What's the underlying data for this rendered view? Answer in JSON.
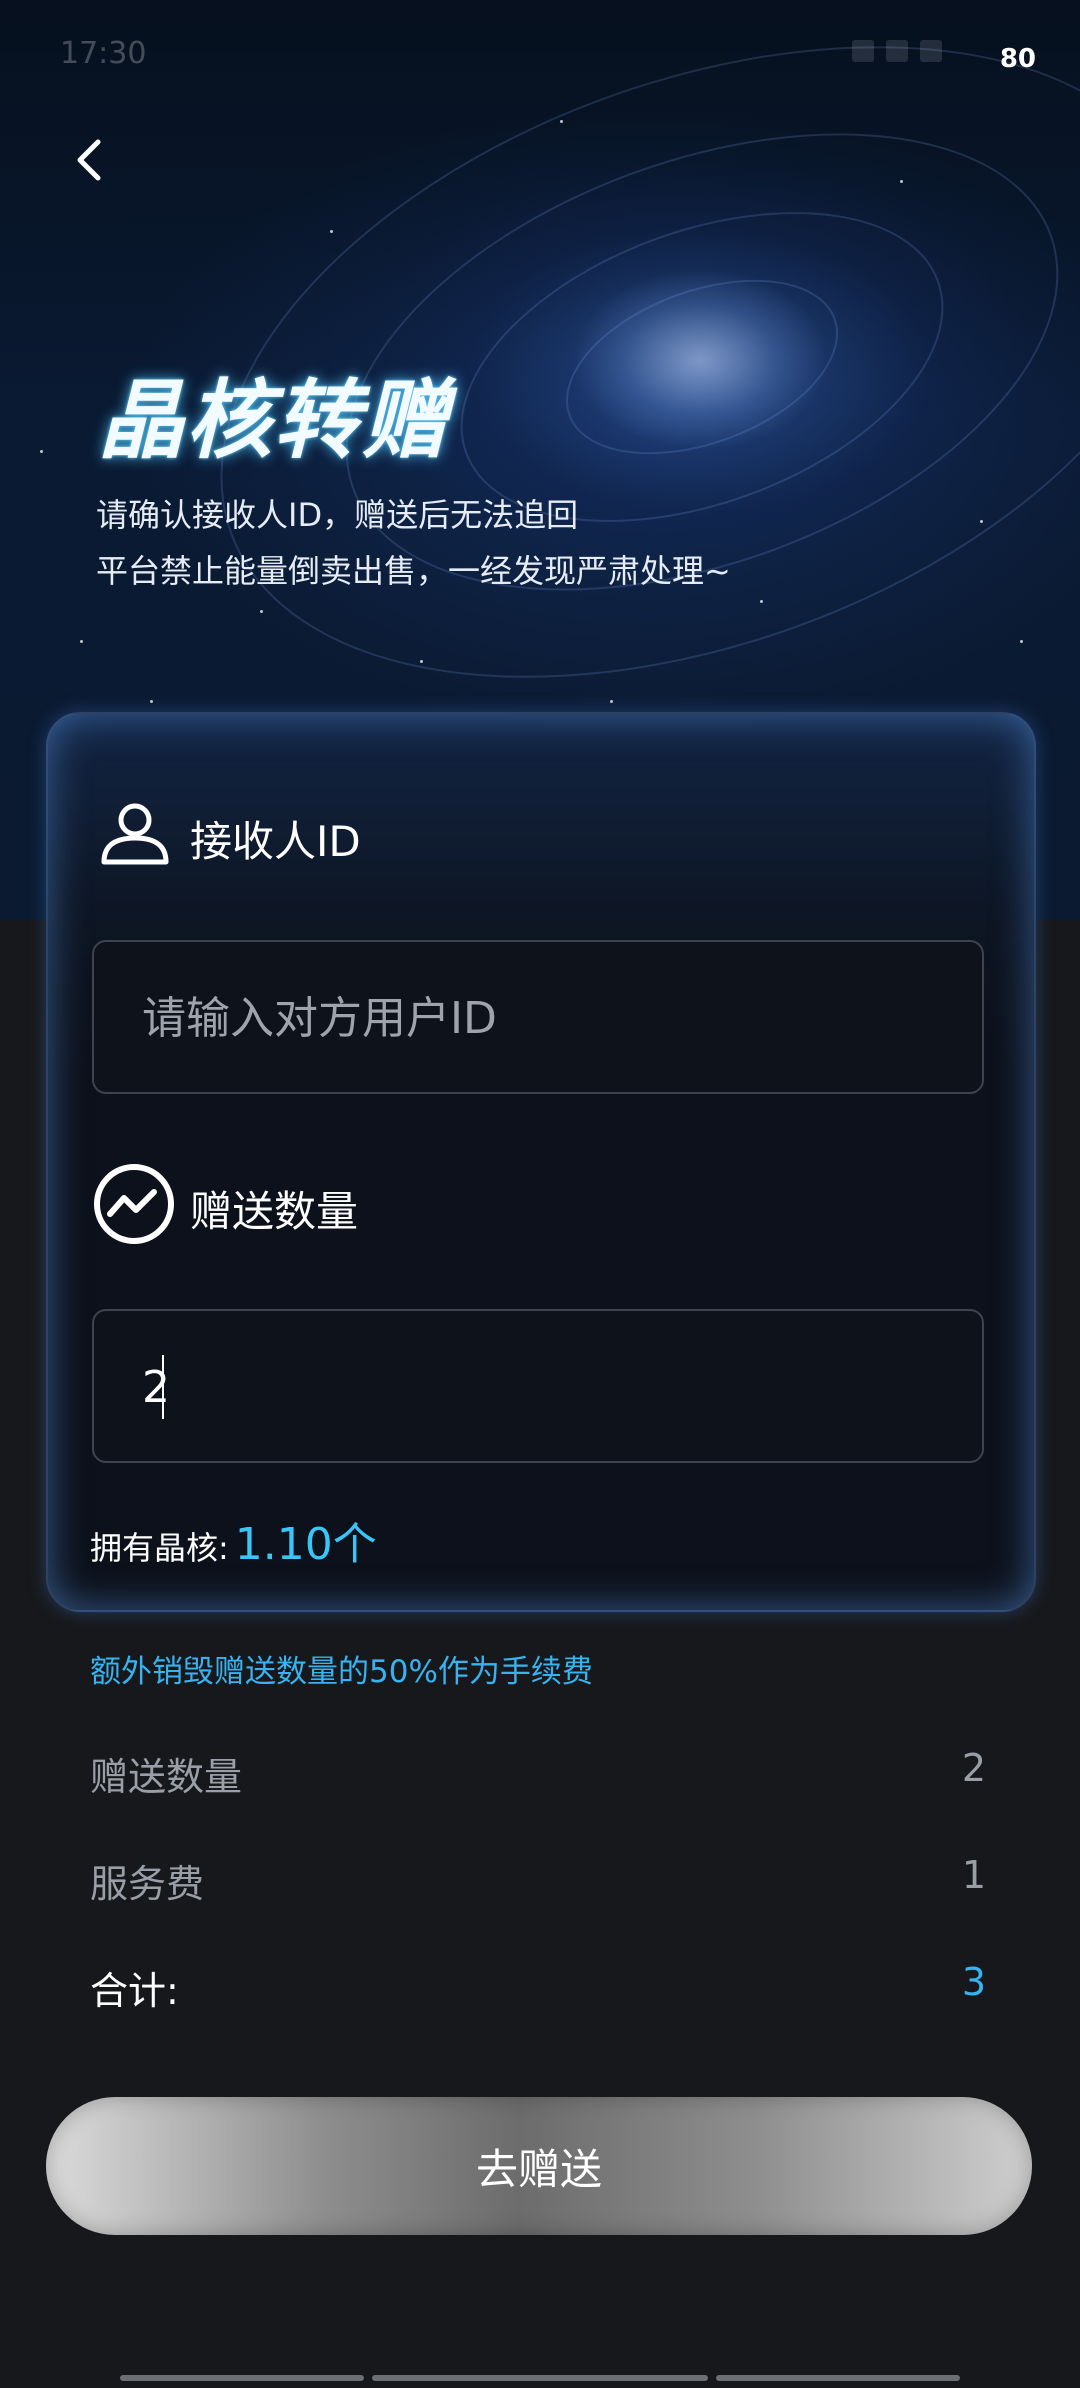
{
  "status_bar": {
    "time": "17:30",
    "battery": "80"
  },
  "header": {
    "title": "晶核转赠",
    "notice_line1": "请确认接收人ID，赠送后无法追回",
    "notice_line2": "平台禁止能量倒卖出售，一经发现严肃处理~"
  },
  "form": {
    "receiver_label": "接收人ID",
    "receiver_placeholder": "请输入对方用户ID",
    "receiver_value": "",
    "amount_label": "赠送数量",
    "amount_value": "2",
    "owned_label": "拥有晶核:",
    "owned_value": "1.10个"
  },
  "summary": {
    "fee_note": "额外销毁赠送数量的50%作为手续费",
    "rows": [
      {
        "label": "赠送数量",
        "value": "2"
      },
      {
        "label": "服务费",
        "value": "1"
      },
      {
        "label": "合计:",
        "value": "3"
      }
    ]
  },
  "actions": {
    "submit_label": "去赠送"
  },
  "colors": {
    "accent": "#36b3f0",
    "background": "#17181b",
    "card": "#0c111b"
  },
  "icons": {
    "back": "chevron-left-icon",
    "receiver": "user-icon",
    "amount": "trend-circle-icon"
  }
}
